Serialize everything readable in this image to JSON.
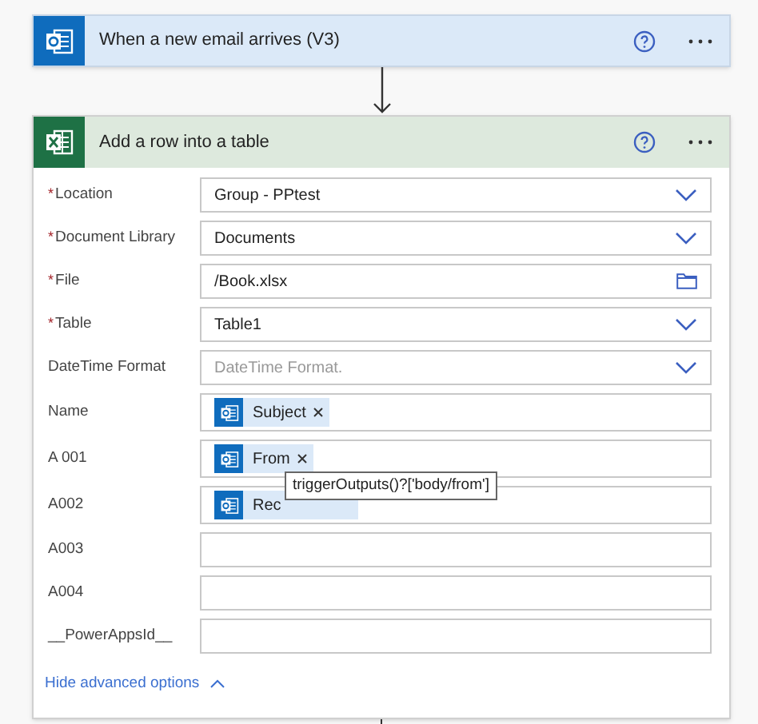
{
  "trigger": {
    "title": "When a new email arrives (V3)"
  },
  "action": {
    "title": "Add a row into a table",
    "fields": [
      {
        "label": "Location",
        "required_mark": "*",
        "kind": "dropdown",
        "value": "Group - PPtest"
      },
      {
        "label": "Document Library",
        "required_mark": "*",
        "kind": "dropdown",
        "value": "Documents"
      },
      {
        "label": "File",
        "required_mark": "*",
        "kind": "file",
        "value": "/Book.xlsx"
      },
      {
        "label": "Table",
        "required_mark": "*",
        "kind": "dropdown",
        "value": "Table1"
      },
      {
        "label": "DateTime Format",
        "kind": "dropdown",
        "placeholder": "DateTime Format."
      },
      {
        "label": "Name",
        "kind": "tokens",
        "tokens": [
          {
            "label": "Subject",
            "removable": true
          }
        ]
      },
      {
        "label": "A 001",
        "kind": "tokens",
        "tokens": [
          {
            "label": "From",
            "removable": true
          }
        ],
        "tooltip": "triggerOutputs()?['body/from']"
      },
      {
        "label": "A002",
        "kind": "tokens",
        "tokens": [
          {
            "label": "Rec",
            "removable": false
          }
        ]
      },
      {
        "label": "A003",
        "kind": "text"
      },
      {
        "label": "A004",
        "kind": "text"
      },
      {
        "label": "__PowerAppsId__",
        "kind": "text"
      }
    ],
    "advanced_link": "Hide advanced options"
  }
}
